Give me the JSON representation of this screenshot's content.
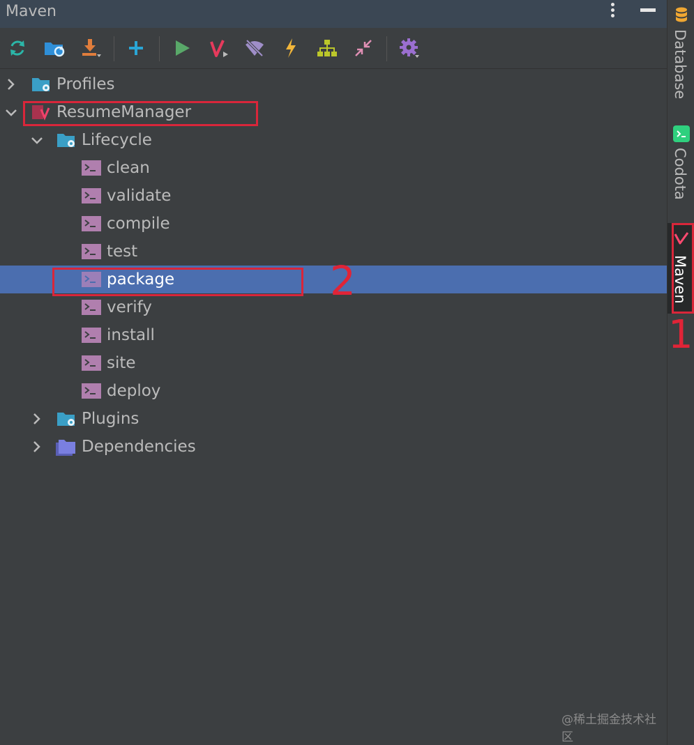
{
  "header": {
    "title": "Maven",
    "more_icon": "more-vertical-icon",
    "hide_icon": "minimize-icon"
  },
  "toolbar": {
    "buttons": [
      {
        "name": "reload-all-maven-projects",
        "icon": "refresh-icon"
      },
      {
        "name": "generate-sources",
        "icon": "folder-refresh-icon"
      },
      {
        "name": "download-sources",
        "icon": "download-icon"
      },
      {
        "name": "add-maven-project",
        "icon": "plus-icon"
      },
      {
        "name": "run-maven-build",
        "icon": "run-icon"
      },
      {
        "name": "execute-maven-goal",
        "icon": "maven-goal-icon"
      },
      {
        "name": "toggle-offline-mode",
        "icon": "offline-icon"
      },
      {
        "name": "skip-tests",
        "icon": "lightning-icon"
      },
      {
        "name": "show-dependencies",
        "icon": "diagram-icon"
      },
      {
        "name": "collapse-all",
        "icon": "collapse-icon"
      },
      {
        "name": "maven-settings",
        "icon": "gear-icon"
      }
    ]
  },
  "tree": {
    "profiles": "Profiles",
    "project": "ResumeManager",
    "lifecycle": "Lifecycle",
    "goals": [
      "clean",
      "validate",
      "compile",
      "test",
      "package",
      "verify",
      "install",
      "site",
      "deploy"
    ],
    "selected_goal": "package",
    "plugins": "Plugins",
    "dependencies": "Dependencies"
  },
  "sidebar": {
    "tabs": [
      {
        "label": "Database",
        "icon": "database-icon"
      },
      {
        "label": "Codota",
        "icon": "codota-icon"
      },
      {
        "label": "Maven",
        "icon": "maven-icon",
        "active": true
      }
    ]
  },
  "annotations": {
    "label_1": "1",
    "label_2": "2"
  },
  "watermark": "@稀土掘金技术社区",
  "colors": {
    "selection": "#4b6eaf",
    "highlight": "#d9263a",
    "maven": "#e63a5c"
  }
}
